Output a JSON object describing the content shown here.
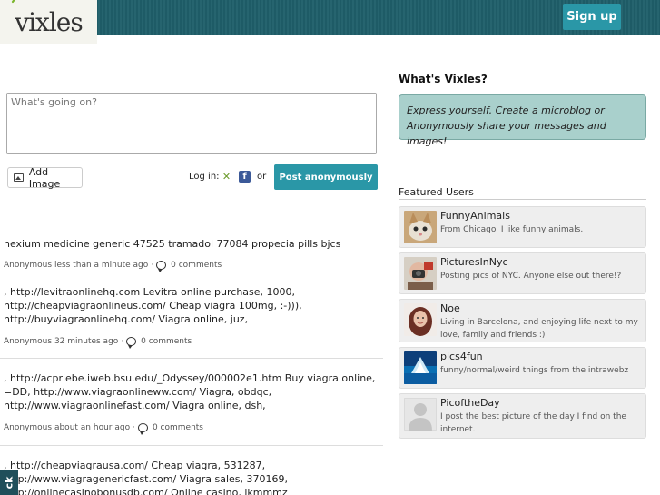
{
  "header": {
    "logo_text": "vixles",
    "signup_label": "Sign up"
  },
  "compose": {
    "placeholder": "What's going on?",
    "add_image_label": "Add Image",
    "login_label": "Log in:",
    "or_label": "or",
    "post_anon_label": "Post anonymously"
  },
  "posts": [
    {
      "text": "nexium medicine generic 47525 tramadol 77084 propecia pills bjcs",
      "author": "Anonymous",
      "time": "less than a minute ago",
      "comments": "0 comments"
    },
    {
      "text": ", http://levitraonlinehq.com Levitra online purchase, 1000, http://cheapviagraonlineus.com/ Cheap viagra 100mg, :-))), http://buyviagraonlinehq.com/ Viagra online, juz,",
      "author": "Anonymous",
      "time": "32 minutes ago",
      "comments": "0 comments"
    },
    {
      "text": ", http://acpriebe.iweb.bsu.edu/_Odyssey/000002e1.htm Buy viagra online, =DD, http://www.viagraonlineww.com/ Viagra, obdqc, http://www.viagraonlinefast.com/ Viagra online, dsh,",
      "author": "Anonymous",
      "time": "about an hour ago",
      "comments": "0 comments"
    },
    {
      "text": ", http://cheapviagrausa.com/ Cheap viagra, 531287, http://www.viagragenericfast.com/ Viagra sales, 370169, http://onlinecasinobonusdb.com/ Online casino, lkmmmz"
    }
  ],
  "sidebar": {
    "title": "What's Vixles?",
    "express_text": "Express yourself. Create a microblog or Anonymously share your messages and images!",
    "featured_title": "Featured Users",
    "users": [
      {
        "name": "FunnyAnimals",
        "desc": "From Chicago. I like funny animals."
      },
      {
        "name": "PicturesInNyc",
        "desc": "Posting pics of NYC. Anyone else out there!?"
      },
      {
        "name": "Noe",
        "desc": "Living in Barcelona, and enjoying life next to my love, family and friends :)"
      },
      {
        "name": "pics4fun",
        "desc": "funny/normal/weird things from the intrawebz"
      },
      {
        "name": "PicoftheDay",
        "desc": "I post the best picture of the day I find on the internet."
      }
    ]
  },
  "feedback_label": "ck",
  "colors": {
    "header": "#1f5f6a",
    "accent": "#2a97a7",
    "express_bg": "#a9d0cc"
  }
}
